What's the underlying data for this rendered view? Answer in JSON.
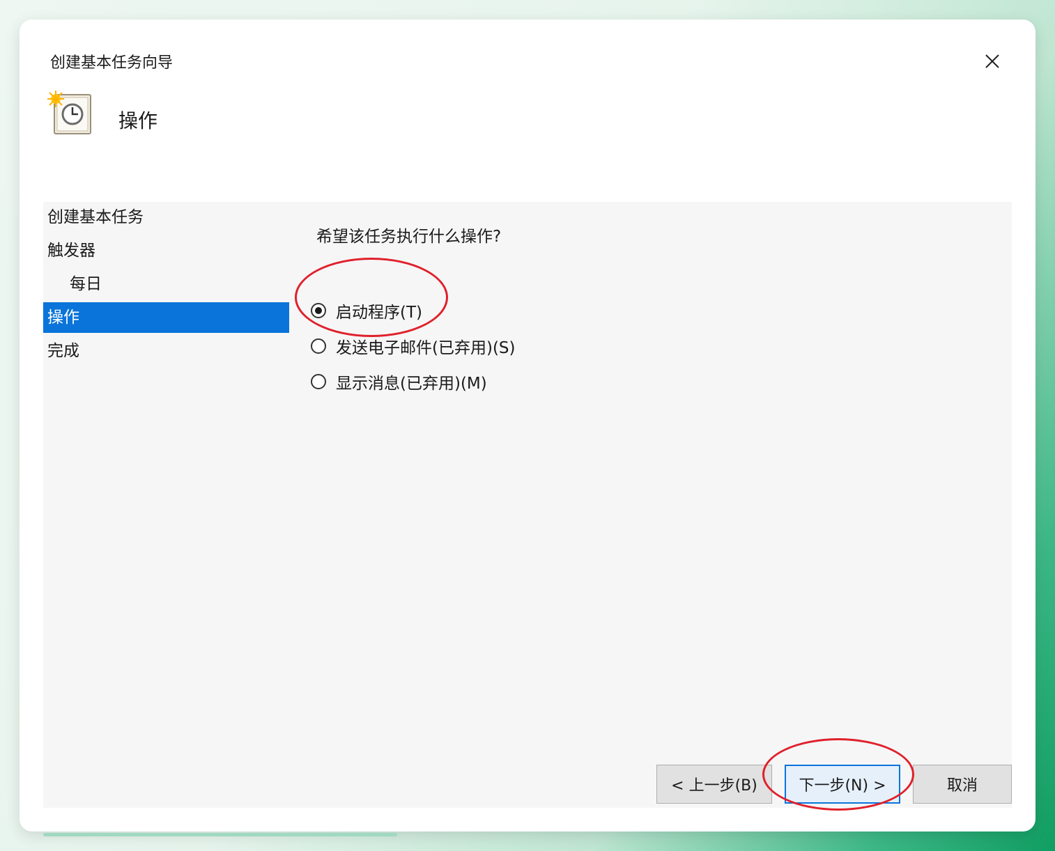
{
  "window": {
    "title": "创建基本任务向导"
  },
  "header": {
    "title": "操作",
    "icon": "scheduled-task-clock-icon"
  },
  "steps": [
    {
      "label": "创建基本任务",
      "active": false,
      "indent": false
    },
    {
      "label": "触发器",
      "active": false,
      "indent": false
    },
    {
      "label": "每日",
      "active": false,
      "indent": true
    },
    {
      "label": "操作",
      "active": true,
      "indent": false
    },
    {
      "label": "完成",
      "active": false,
      "indent": false
    }
  ],
  "question": "希望该任务执行什么操作?",
  "options": [
    {
      "label": "启动程序(T)",
      "selected": true
    },
    {
      "label": "发送电子邮件(已弃用)(S)",
      "selected": false
    },
    {
      "label": "显示消息(已弃用)(M)",
      "selected": false
    }
  ],
  "buttons": {
    "back": "< 上一步(B)",
    "next": "下一步(N) >",
    "cancel": "取消"
  },
  "colors": {
    "accent": "#0a74da",
    "annotation": "#e0202b",
    "panel_bg": "#f6f6f6"
  }
}
